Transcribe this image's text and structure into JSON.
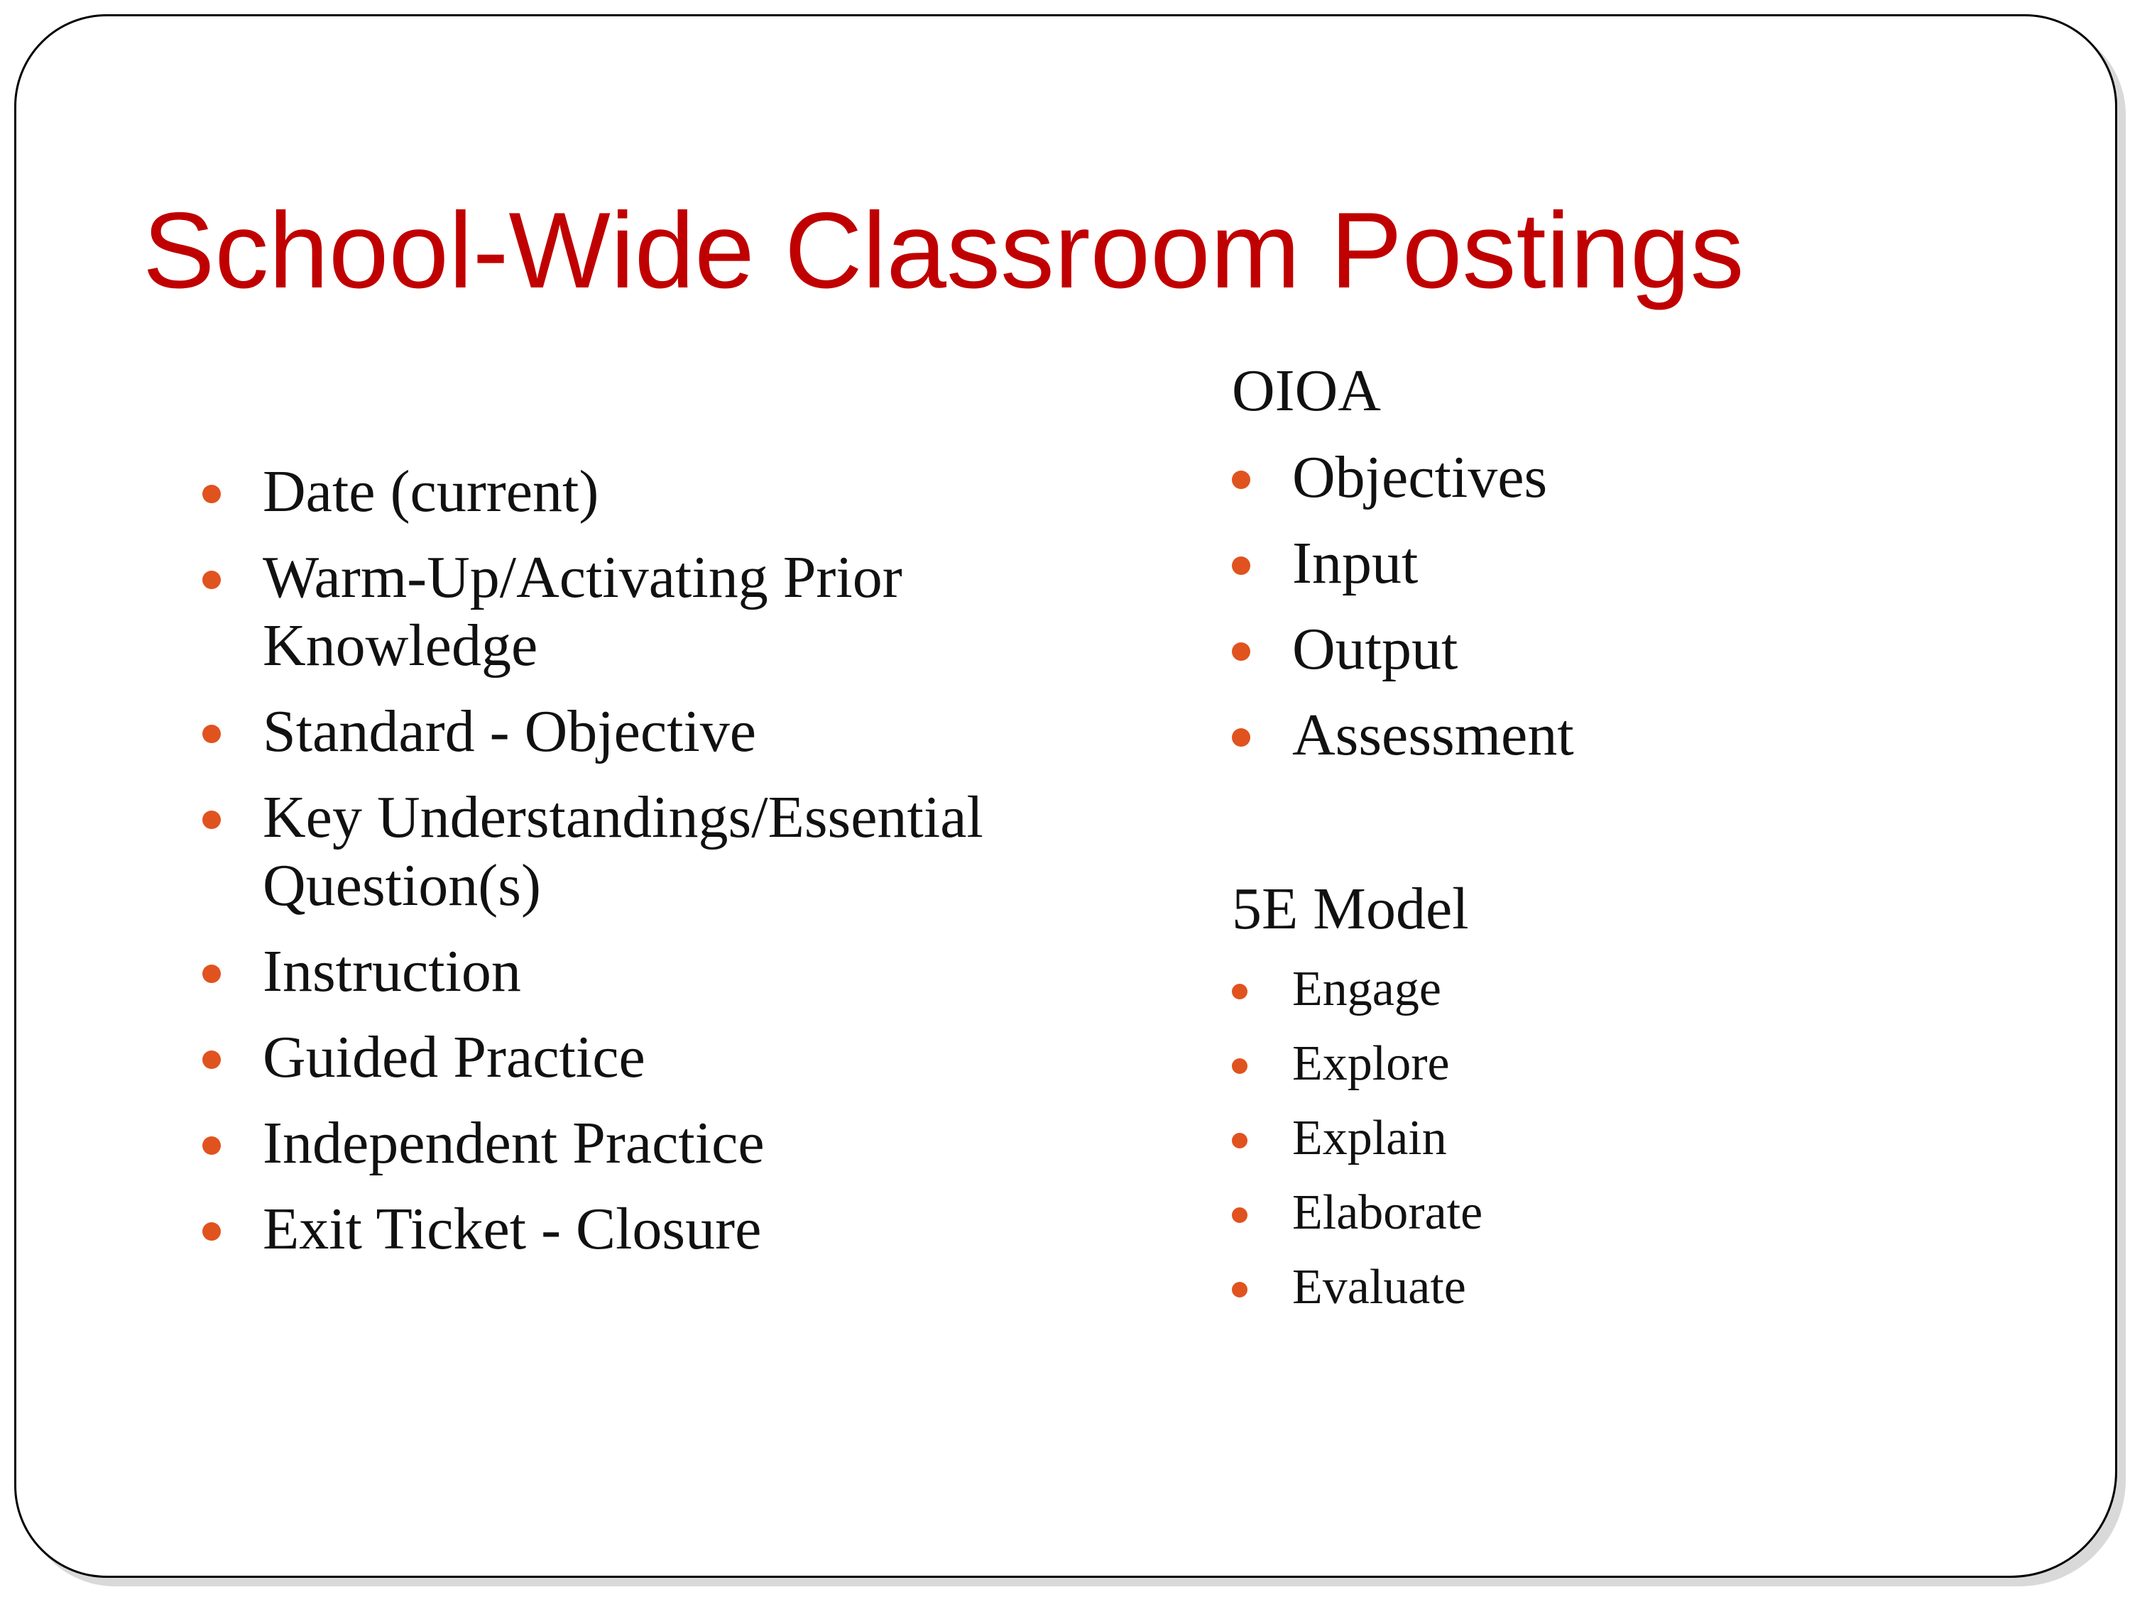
{
  "slide": {
    "title": "School-Wide Classroom Postings",
    "accent_color": "#c00000",
    "bullet_color": "#e0531f",
    "left_items": [
      {
        "lines": [
          "Date (current)"
        ]
      },
      {
        "lines": [
          "Warm-Up/Activating Prior",
          "Knowledge"
        ]
      },
      {
        "lines": [
          "Standard - Objective"
        ]
      },
      {
        "lines": [
          "Key Understandings/Essential",
          "Question(s)"
        ]
      },
      {
        "lines": [
          "Instruction"
        ]
      },
      {
        "lines": [
          "Guided Practice"
        ]
      },
      {
        "lines": [
          "Independent Practice"
        ]
      },
      {
        "lines": [
          "Exit Ticket - Closure"
        ]
      }
    ],
    "oioa": {
      "heading": "OIOA",
      "items": [
        "Objectives",
        "Input",
        "Output",
        "Assessment"
      ]
    },
    "model": {
      "heading": "5E Model",
      "items": [
        "Engage",
        "Explore",
        "Explain",
        "Elaborate",
        "Evaluate"
      ]
    }
  }
}
